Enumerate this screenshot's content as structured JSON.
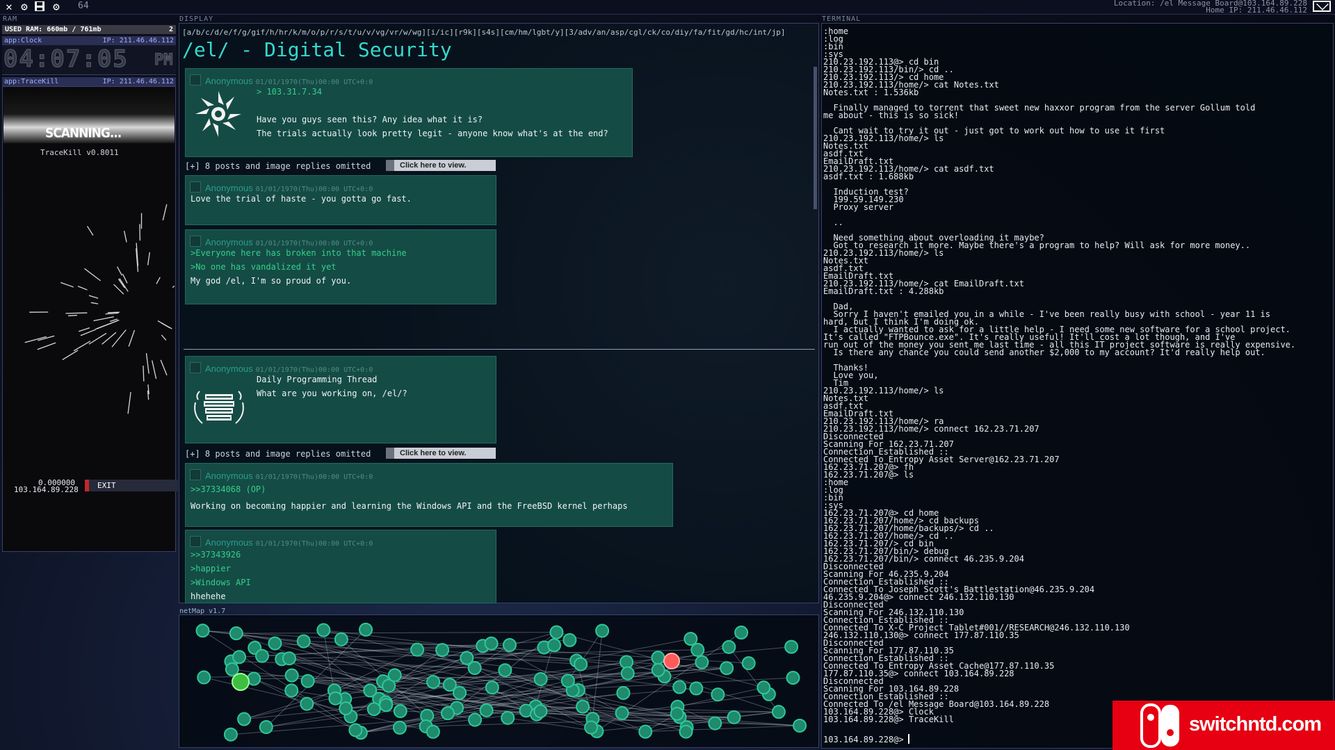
{
  "topbar": {
    "icons": [
      "close-icon",
      "gear-icon",
      "save-icon",
      "settings-icon"
    ],
    "number": "64",
    "location": "Location: /el Message Board@103.164.89.228",
    "home_ip": "Home IP: 211.46.46.112"
  },
  "ram": {
    "label": "RAM",
    "used": "USED RAM: 660mb / 761mb",
    "count": "2"
  },
  "clock_app": {
    "name": "app:Clock",
    "ip": "IP: 211.46.46.112",
    "time": "04:07:05",
    "ampm": "PM"
  },
  "tracekill_app": {
    "name": "app:TraceKill",
    "ip": "IP: 211.46.46.112",
    "status": "SCANNING...",
    "version": "TraceKill v0.8011",
    "value": "0.000000",
    "target_ip": "103.164.89.228",
    "exit_label": "EXIT"
  },
  "display": {
    "label": "DISPLAY",
    "boards": "[a/b/c/d/e/f/g/gif/h/hr/k/m/o/p/r/s/t/u/v/vg/vr/w/wg][i/ic][r9k][s4s][cm/hm/lgbt/y][3/adv/an/asp/cgl/ck/co/diy/fa/fit/gd/hc/int/jp]",
    "title": "/el/ - Digital Security",
    "threads": [
      {
        "op": {
          "name": "Anonymous",
          "meta": "01/01/1970(Thu)00:00 UTC+0:0",
          "ref": "> 103.31.7.34",
          "lines": [
            "Have you guys seen this? Any idea what it is?",
            "The trials actually look pretty legit - anyone know what's at the end?"
          ],
          "image": "spiral-emblem-icon"
        },
        "omitted": "[+] 8 posts and image replies omitted",
        "view_label": "Click here to view.",
        "replies": [
          {
            "name": "Anonymous",
            "meta": "01/01/1970(Thu)00:00 UTC+0:0",
            "lines": [
              "Love the trial of haste - you gotta go fast."
            ]
          },
          {
            "name": "Anonymous",
            "meta": "01/01/1970(Thu)00:00 UTC+0:0",
            "green": [
              ">Everyone here has broken into that machine",
              ">No one has vandalized it yet"
            ],
            "lines": [
              "My god /el, I'm so proud of you."
            ]
          }
        ]
      },
      {
        "op": {
          "name": "Anonymous",
          "meta": "01/01/1970(Thu)00:00 UTC+0:0",
          "lines": [
            "Daily Programming Thread",
            "What are you working on, /el/?"
          ],
          "image": "books-emblem-icon"
        },
        "omitted": "[+] 8 posts and image replies omitted",
        "view_label": "Click here to view.",
        "replies": [
          {
            "name": "Anonymous",
            "meta": "01/01/1970(Thu)00:00 UTC+0:0",
            "green": [
              ">>37334068 (OP)"
            ],
            "lines": [
              "Working on becoming happier and learning the Windows API and the FreeBSD kernel perhaps"
            ]
          },
          {
            "name": "Anonymous",
            "meta": "01/01/1970(Thu)00:00 UTC+0:0",
            "green": [
              ">>37343926",
              ">happier",
              ">Windows API"
            ],
            "lines": [
              "hhehehe"
            ]
          }
        ]
      }
    ]
  },
  "netmap": {
    "label": "netMap v1.7"
  },
  "terminal": {
    "label": "TERMINAL",
    "lines": [
      ":home",
      ":log",
      ":bin",
      ":sys",
      "210.23.192.113@> cd bin",
      "210.23.192.113/bin/> cd ..",
      "210.23.192.113/> cd home",
      "210.23.192.113/home/> cat Notes.txt",
      "Notes.txt : 1.536kb",
      "",
      "  Finally managed to torrent that sweet new haxxor program from the server Gollum told",
      "me about - this is so sick!",
      "",
      "  Cant wait to try it out - just got to work out how to use it first",
      "210.23.192.113/home/> ls",
      "Notes.txt",
      "asdf.txt",
      "EmailDraft.txt",
      "210.23.192.113/home/> cat asdf.txt",
      "asdf.txt : 1.688kb",
      "",
      "  Induction test?",
      "  199.59.149.230",
      "  Proxy server",
      "",
      "  ..",
      "",
      "  Need something about overloading it maybe?",
      "  Got to research it more. Maybe there's a program to help? Will ask for more money..",
      "210.23.192.113/home/> ls",
      "Notes.txt",
      "asdf.txt",
      "EmailDraft.txt",
      "210.23.192.113/home/> cat EmailDraft.txt",
      "EmailDraft.txt : 4.288kb",
      "",
      "  Dad,",
      "  Sorry I haven't emailed you in a while - I've been really busy with school - year 11 is",
      "hard, but I think I'm doing ok.",
      "  I actually wanted to ask for a little help - I need some new software for a school project.",
      "It's called \"FTPBounce.exe\". It's really useful! It'll cost a lot though, and I've",
      "run out of the money you sent me last time - all this IT project software is really expensive.",
      "  Is there any chance you could send another $2,000 to my account? It'd really help out.",
      "",
      "  Thanks!",
      "  Love you,",
      "  Tim",
      "210.23.192.113/home/> ls",
      "Notes.txt",
      "asdf.txt",
      "EmailDraft.txt",
      "210.23.192.113/home/> ra",
      "210.23.192.113/home/> connect 162.23.71.207",
      "Disconnected",
      "Scanning For 162.23.71.207",
      "Connection Established ::",
      "Connected To Entropy Asset Server@162.23.71.207",
      "162.23.71.207@> fh",
      "162.23.71.207@> ls",
      ":home",
      ":log",
      ":bin",
      ":sys",
      "162.23.71.207@> cd home",
      "162.23.71.207/home/> cd backups",
      "162.23.71.207/home/backups/> cd ..",
      "162.23.71.207/home/> cd ..",
      "162.23.71.207/> cd bin",
      "162.23.71.207/bin/> debug",
      "162.23.71.207/bin/> connect 46.235.9.204",
      "Disconnected",
      "Scanning For 46.235.9.204",
      "Connection Established ::",
      "Connected To Joseph Scott's Battlestation@46.235.9.204",
      "46.235.9.204@> connect 246.132.110.130",
      "Disconnected",
      "Scanning For 246.132.110.130",
      "Connection Established ::",
      "Connected To X-C Project Tablet#001//RESEARCH@246.132.110.130",
      "246.132.110.130@> connect 177.87.110.35",
      "Disconnected",
      "Scanning For 177.87.110.35",
      "Connection Established ::",
      "Connected To Entropy Asset Cache@177.87.110.35",
      "177.87.110.35@> connect 103.164.89.228",
      "Disconnected",
      "Scanning For 103.164.89.228",
      "Connection Established ::",
      "Connected To /el Message Board@103.164.89.228",
      "103.164.89.228@> Clock",
      "103.164.89.228@> TraceKill"
    ],
    "prompt": "103.164.89.228@>"
  },
  "watermark": {
    "text": "switchntd.com",
    "logo": "switch-logo-icon"
  },
  "colors": {
    "accent": "#34d9cc",
    "post_bg": "#154b45",
    "greentext": "#33d08a",
    "exit_red": "#c0282a",
    "node": "#2fc79a",
    "node_alert": "#ff5a5a"
  }
}
